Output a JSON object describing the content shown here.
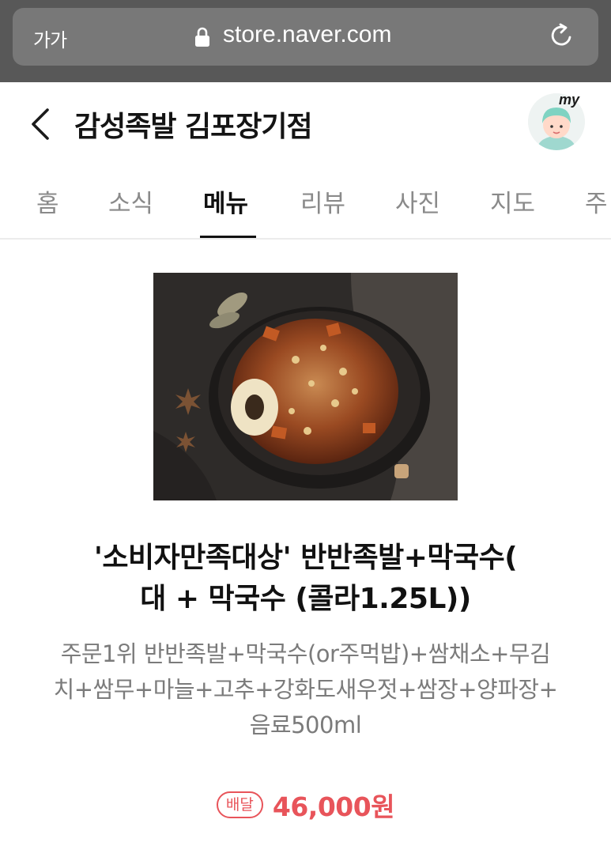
{
  "browser": {
    "text_size_button": "가가",
    "url": "store.naver.com"
  },
  "header": {
    "store_name": "감성족발 김포장기점",
    "profile_label": "my"
  },
  "tabs": [
    {
      "label": "홈",
      "active": false
    },
    {
      "label": "소식",
      "active": false
    },
    {
      "label": "메뉴",
      "active": true
    },
    {
      "label": "리뷰",
      "active": false
    },
    {
      "label": "사진",
      "active": false
    },
    {
      "label": "지도",
      "active": false
    },
    {
      "label": "주",
      "active": false
    }
  ],
  "menu": {
    "name_line1": "'소비자만족대상' 반반족발+막국수(",
    "name_line2": "대 + 막국수 (콜라1.25L))",
    "desc_line1": "주문1위 반반족발+막국수(or주먹밥)+쌈채소+무김",
    "desc_line2": "치+쌈무+마늘+고추+강화도새우젓+쌈장+양파장+",
    "desc_line3": "음료500ml",
    "badge": "배달",
    "price": "46,000원"
  },
  "colors": {
    "accent": "#e8545a",
    "browser_bar": "#585858",
    "active_tab": "#111111",
    "inactive_tab": "#8a8a8a"
  }
}
